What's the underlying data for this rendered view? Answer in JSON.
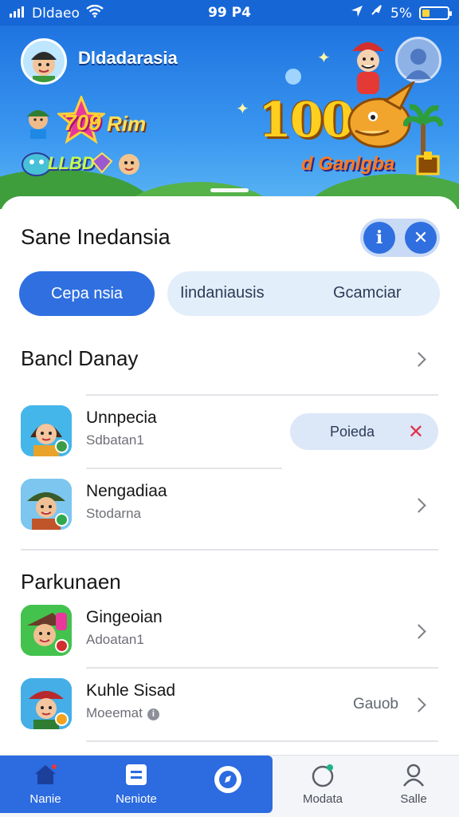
{
  "status_bar": {
    "carrier": "Dldaeo",
    "time": "99 P4",
    "battery": "5%",
    "battery_level": 0.05
  },
  "hero": {
    "user_name": "Dldadarasia",
    "score_text": "100",
    "tags": [
      "709",
      "Rim",
      "LLBD"
    ],
    "brand": "d Ganlgba"
  },
  "sheet": {
    "title": "Sane Inedansia",
    "segments": {
      "active": "Cepa nsia",
      "others": [
        "Iindaniausis",
        "Gcamciar"
      ]
    },
    "sections": [
      {
        "title": "Bancl Danay",
        "items": [
          {
            "title": "Unnpecia",
            "subtitle": "Sdbatan1",
            "chip": "Poieda",
            "badge_color": "#3c9c4a"
          },
          {
            "title": "Nengadiaa",
            "subtitle": "Stodarna",
            "badge_color": "#2fa84f"
          }
        ]
      },
      {
        "title": "Parkunaen",
        "items": [
          {
            "title": "Gingeoian",
            "subtitle": "Adoatan1",
            "badge_color": "#d32f2f"
          },
          {
            "title": "Kuhle Sisad",
            "subtitle": "Moeemat",
            "trailing": "Gauob",
            "badge_color": "#f3a31b"
          }
        ]
      }
    ]
  },
  "bottom_nav": [
    {
      "label": "Nanie",
      "icon": "home-icon",
      "active": true
    },
    {
      "label": "Neniote",
      "icon": "list-icon"
    },
    {
      "label": "",
      "icon": "compass-icon"
    },
    {
      "label": "Modata",
      "icon": "circle-icon"
    },
    {
      "label": "Salle",
      "icon": "profile-icon"
    }
  ],
  "colors": {
    "primary": "#2f6fe0",
    "status_bar": "#1766d6",
    "chip_bg": "#dce7f8",
    "close_red": "#e0344a"
  }
}
